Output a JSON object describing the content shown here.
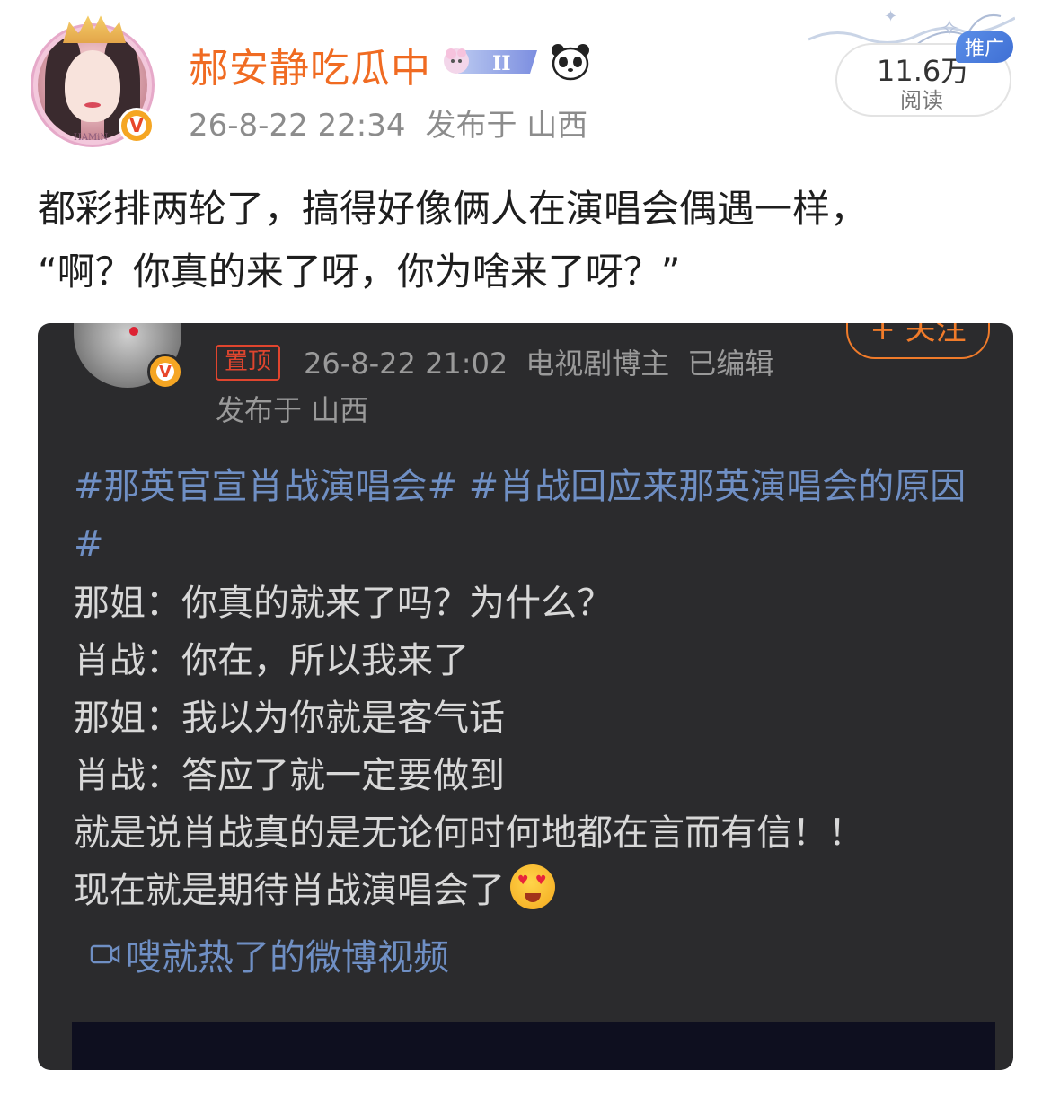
{
  "author": {
    "name": "郝安静吃瓜中",
    "avatar_tag": "HAMiN",
    "time": "26-8-22 22:34",
    "location": "发布于 山西"
  },
  "stats": {
    "reads": "11.6万",
    "reads_label": "阅读",
    "promo": "推广"
  },
  "post": {
    "lines": [
      "都彩排两轮了，搞得好像俩人在演唱会偶遇一样，",
      "“啊？你真的来了呀，你为啥来了呀？”"
    ]
  },
  "embedded": {
    "follow_label": "+ 关注",
    "pin_label": "置顶",
    "time": "26-8-22 21:02",
    "role": "电视剧博主",
    "edited": "已编辑",
    "location": "发布于 山西",
    "hashtags": "#那英官宣肖战演唱会# #肖战回应来那英演唱会的原因#",
    "lines": [
      "那姐：你真的就来了吗？为什么？",
      "肖战：你在，所以我来了",
      "那姐：我以为你就是客气话",
      "肖战：答应了就一定要做到",
      "就是说肖战真的是无论何时何地都在言而有信！！",
      "现在就是期待肖战演唱会了"
    ],
    "video_link": "嗖就热了的微博视频"
  },
  "icons": {
    "verified": "verified-v-icon",
    "badge": "gemini-badge-icon",
    "panda": "panda-icon",
    "emoji": "heart-eyes-emoji-icon",
    "video": "video-camera-icon"
  },
  "colors": {
    "username": "#f06b22",
    "link": "#6f8fc4",
    "promo": "#3f6fd4",
    "pin": "#e0452e"
  }
}
